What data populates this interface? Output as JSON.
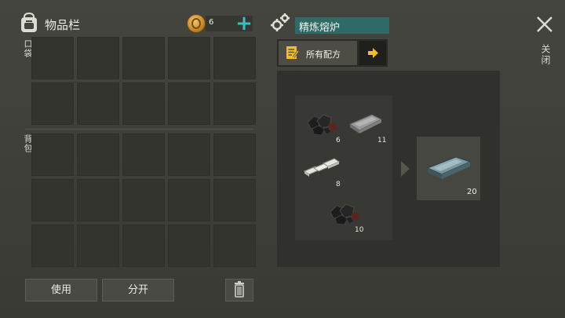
{
  "inventory": {
    "title": "物品栏",
    "coin_count": "6",
    "pocket_label": "口袋",
    "backpack_label": "背包",
    "pocket_slots": 10,
    "backpack_slots": 15,
    "use_label": "使用",
    "split_label": "分开"
  },
  "furnace": {
    "title": "精炼熔炉",
    "recipes_label": "所有配方",
    "inputs": [
      {
        "icon": "coal-icon",
        "count": "6"
      },
      {
        "icon": "iron-bar-icon",
        "count": "11"
      },
      {
        "icon": "silver-bars-icon",
        "count": "8"
      },
      {
        "icon": "coal-icon",
        "count": "10"
      }
    ],
    "output": {
      "icon": "steel-ingot-icon",
      "count": "20"
    }
  },
  "close_label": "关闭",
  "colors": {
    "accent": "#38c0c0",
    "title_bar": "#2f6a68",
    "arrow": "#f0c020"
  }
}
